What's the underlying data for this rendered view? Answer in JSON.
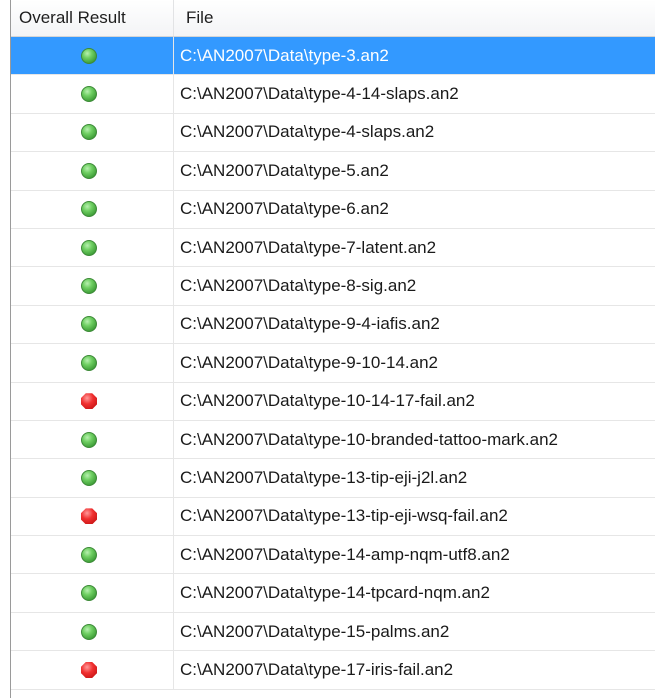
{
  "columns": {
    "result": "Overall Result",
    "file": "File"
  },
  "colors": {
    "selection": "#3399ff",
    "pass": "#4caf50",
    "fail": "#e02020"
  },
  "rows": [
    {
      "status": "pass",
      "status_icon": "pass-icon",
      "file": "C:\\AN2007\\Data\\type-3.an2",
      "selected": true
    },
    {
      "status": "pass",
      "status_icon": "pass-icon",
      "file": "C:\\AN2007\\Data\\type-4-14-slaps.an2",
      "selected": false
    },
    {
      "status": "pass",
      "status_icon": "pass-icon",
      "file": "C:\\AN2007\\Data\\type-4-slaps.an2",
      "selected": false
    },
    {
      "status": "pass",
      "status_icon": "pass-icon",
      "file": "C:\\AN2007\\Data\\type-5.an2",
      "selected": false
    },
    {
      "status": "pass",
      "status_icon": "pass-icon",
      "file": "C:\\AN2007\\Data\\type-6.an2",
      "selected": false
    },
    {
      "status": "pass",
      "status_icon": "pass-icon",
      "file": "C:\\AN2007\\Data\\type-7-latent.an2",
      "selected": false
    },
    {
      "status": "pass",
      "status_icon": "pass-icon",
      "file": "C:\\AN2007\\Data\\type-8-sig.an2",
      "selected": false
    },
    {
      "status": "pass",
      "status_icon": "pass-icon",
      "file": "C:\\AN2007\\Data\\type-9-4-iafis.an2",
      "selected": false
    },
    {
      "status": "pass",
      "status_icon": "pass-icon",
      "file": "C:\\AN2007\\Data\\type-9-10-14.an2",
      "selected": false
    },
    {
      "status": "fail",
      "status_icon": "fail-icon",
      "file": "C:\\AN2007\\Data\\type-10-14-17-fail.an2",
      "selected": false
    },
    {
      "status": "pass",
      "status_icon": "pass-icon",
      "file": "C:\\AN2007\\Data\\type-10-branded-tattoo-mark.an2",
      "selected": false
    },
    {
      "status": "pass",
      "status_icon": "pass-icon",
      "file": "C:\\AN2007\\Data\\type-13-tip-eji-j2l.an2",
      "selected": false
    },
    {
      "status": "fail",
      "status_icon": "fail-icon",
      "file": "C:\\AN2007\\Data\\type-13-tip-eji-wsq-fail.an2",
      "selected": false
    },
    {
      "status": "pass",
      "status_icon": "pass-icon",
      "file": "C:\\AN2007\\Data\\type-14-amp-nqm-utf8.an2",
      "selected": false
    },
    {
      "status": "pass",
      "status_icon": "pass-icon",
      "file": "C:\\AN2007\\Data\\type-14-tpcard-nqm.an2",
      "selected": false
    },
    {
      "status": "pass",
      "status_icon": "pass-icon",
      "file": "C:\\AN2007\\Data\\type-15-palms.an2",
      "selected": false
    },
    {
      "status": "fail",
      "status_icon": "fail-icon",
      "file": "C:\\AN2007\\Data\\type-17-iris-fail.an2",
      "selected": false
    }
  ]
}
